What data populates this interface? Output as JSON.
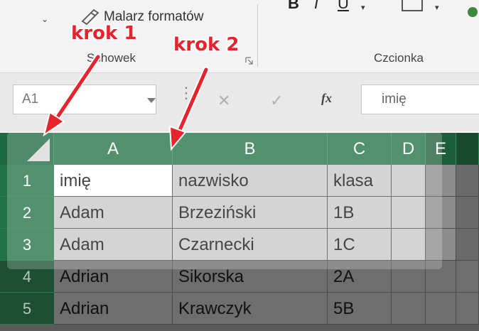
{
  "ribbon": {
    "painter_label": "Malarz formatów",
    "clipboard_group": "Schowek",
    "font_group": "Czcionka",
    "bold": "B",
    "italic": "I",
    "underline": "U"
  },
  "formula_bar": {
    "name_box": "A1",
    "fx_label": "fx",
    "formula_value": "imię"
  },
  "grid": {
    "columns": [
      "A",
      "B",
      "C",
      "D",
      "E"
    ],
    "rows": [
      {
        "num": "1",
        "cells": [
          "imię",
          "nazwisko",
          "klasa"
        ]
      },
      {
        "num": "2",
        "cells": [
          "Adam",
          "Brzeziński",
          "1B"
        ]
      },
      {
        "num": "3",
        "cells": [
          "Adam",
          "Czarnecki",
          "1C"
        ]
      },
      {
        "num": "4",
        "cells": [
          "Adrian",
          "Sikorska",
          "2A"
        ]
      },
      {
        "num": "5",
        "cells": [
          "Adrian",
          "Krawczyk",
          "5B"
        ]
      }
    ]
  },
  "annotations": {
    "step1": "krok 1",
    "step2": "krok 2",
    "color": "#e8232b"
  },
  "colors": {
    "header_green": "#217346",
    "row_header_selected": "#217346",
    "row_header_dim": "#1a4a2e"
  }
}
